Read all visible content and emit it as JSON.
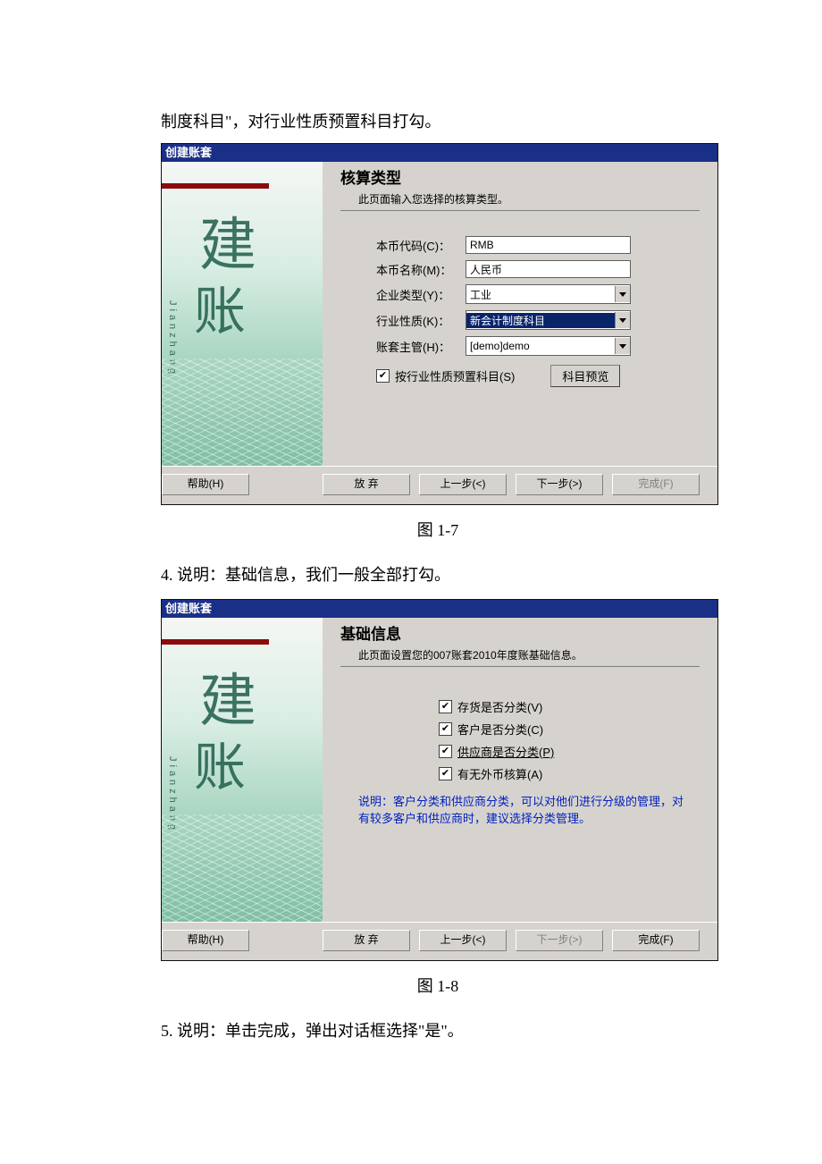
{
  "intro_text": "制度科目\"，对行业性质预置科目打勾。",
  "caption1": "图 1-7",
  "item4": "4. 说明：基础信息，我们一般全部打勾。",
  "caption2": "图 1-8",
  "item5": "5. 说明：单击完成，弹出对话框选择\"是\"。",
  "dialog1": {
    "title": "创建账套",
    "panel_title": "核算类型",
    "panel_sub": "此页面输入您选择的核算类型。",
    "side_c1": "建",
    "side_c2": "账",
    "pinyin": "Jianzhang",
    "labels": {
      "currency_code": "本币代码(C)：",
      "currency_name": "本币名称(M)：",
      "enterprise_type": "企业类型(Y)：",
      "industry_nature": "行业性质(K)：",
      "supervisor": "账套主管(H)："
    },
    "values": {
      "currency_code": "RMB",
      "currency_name": "人民币",
      "enterprise_type": "工业",
      "industry_nature": "新会计制度科目",
      "supervisor": "[demo]demo"
    },
    "preset_checkbox": "按行业性质预置科目(S)",
    "preview_btn": "科目预览",
    "buttons": {
      "help": "帮助(H)",
      "abort": "放 弃",
      "prev": "上一步(<)",
      "next": "下一步(>)",
      "finish": "完成(F)"
    }
  },
  "dialog2": {
    "title": "创建账套",
    "panel_title": "基础信息",
    "panel_sub": "此页面设置您的007账套2010年度账基础信息。",
    "side_c1": "建",
    "side_c2": "账",
    "pinyin": "Jianzhang",
    "checks": {
      "inventory": "存货是否分类(V)",
      "customer": "客户是否分类(C)",
      "supplier": "供应商是否分类(P)",
      "foreign": "有无外币核算(A)"
    },
    "note": "说明：客户分类和供应商分类，可以对他们进行分级的管理，对有较多客户和供应商时，建议选择分类管理。",
    "buttons": {
      "help": "帮助(H)",
      "abort": "放 弃",
      "prev": "上一步(<)",
      "next": "下一步(>)",
      "finish": "完成(F)"
    }
  }
}
